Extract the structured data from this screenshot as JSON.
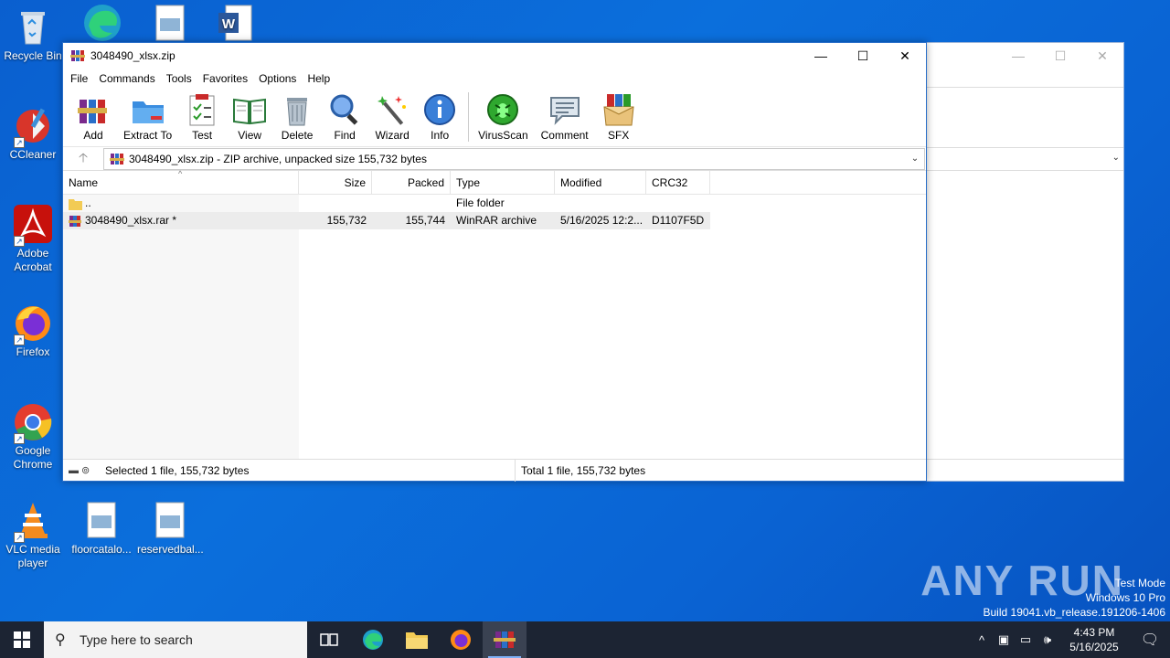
{
  "desktop": {
    "icons": [
      {
        "label": "Recycle Bin"
      },
      {
        "label": "CCleaner"
      },
      {
        "label": "Adobe\nAcrobat"
      },
      {
        "label": "Firefox"
      },
      {
        "label": "Google\nChrome"
      },
      {
        "label": "VLC media\nplayer"
      },
      {
        "label": "floorcatalo..."
      },
      {
        "label": "reservedbal..."
      }
    ],
    "watermark": "ANY RUN",
    "os_info": {
      "line1": "Test Mode",
      "line2": "Windows 10 Pro",
      "line3": "Build 19041.vb_release.191206-1406"
    }
  },
  "window": {
    "title": "3048490_xlsx.zip",
    "controls": {
      "minimize": "—",
      "maximize": "☐",
      "close": "✕"
    },
    "menu": [
      "File",
      "Commands",
      "Tools",
      "Favorites",
      "Options",
      "Help"
    ],
    "toolbar": [
      {
        "label": "Add",
        "icon": "add-icon"
      },
      {
        "label": "Extract To",
        "icon": "extract-icon"
      },
      {
        "label": "Test",
        "icon": "test-icon"
      },
      {
        "label": "View",
        "icon": "view-icon"
      },
      {
        "label": "Delete",
        "icon": "delete-icon"
      },
      {
        "label": "Find",
        "icon": "find-icon"
      },
      {
        "label": "Wizard",
        "icon": "wizard-icon"
      },
      {
        "label": "Info",
        "icon": "info-icon"
      },
      {
        "label": "VirusScan",
        "icon": "virusscan-icon"
      },
      {
        "label": "Comment",
        "icon": "comment-icon"
      },
      {
        "label": "SFX",
        "icon": "sfx-icon"
      }
    ],
    "address": "3048490_xlsx.zip - ZIP archive, unpacked size 155,732 bytes",
    "columns": {
      "name": "Name",
      "size": "Size",
      "packed": "Packed",
      "type": "Type",
      "modified": "Modified",
      "crc": "CRC32"
    },
    "rows": [
      {
        "name": "..",
        "size": "",
        "packed": "",
        "type": "File folder",
        "modified": "",
        "crc": ""
      },
      {
        "name": "3048490_xlsx.rar *",
        "size": "155,732",
        "packed": "155,744",
        "type": "WinRAR archive",
        "modified": "5/16/2025 12:2...",
        "crc": "D1107F5D"
      }
    ],
    "status": {
      "left": "Selected 1 file, 155,732 bytes",
      "right": "Total 1 file, 155,732 bytes"
    }
  },
  "taskbar": {
    "search_placeholder": "Type here to search",
    "clock_time": "4:43 PM",
    "clock_date": "5/16/2025"
  }
}
